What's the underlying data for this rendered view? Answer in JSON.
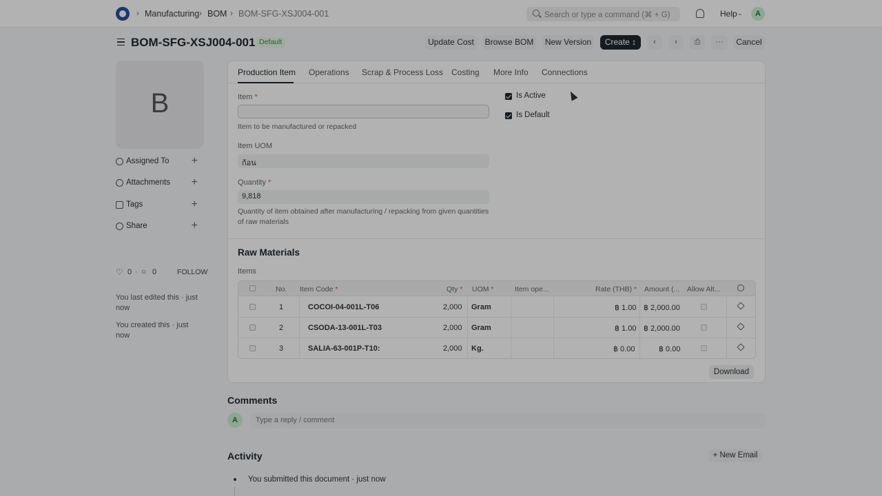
{
  "topbar": {
    "breadcrumbs": [
      "Manufacturing",
      "BOM",
      "BOM-SFG-XSJ004-001"
    ],
    "search_placeholder": "Search or type a command (⌘ + G)",
    "help_label": "Help",
    "avatar_initial": "A"
  },
  "header": {
    "title": "BOM-SFG-XSJ004-001",
    "status_badge": "Default",
    "buttons": {
      "update_cost": "Update Cost",
      "browse_bom": "Browse BOM",
      "new_version": "New Version",
      "create": "Create ↕",
      "prev": "‹",
      "next": "›",
      "print": "⎙",
      "more": "···",
      "cancel": "Cancel"
    }
  },
  "sidebar": {
    "image_letter": "B",
    "items": [
      {
        "label": "Assigned To",
        "icon": "assign-icon"
      },
      {
        "label": "Attachments",
        "icon": "paperclip-icon"
      },
      {
        "label": "Tags",
        "icon": "tag-icon"
      },
      {
        "label": "Share",
        "icon": "share-icon"
      }
    ],
    "likes": "0",
    "comments": "0",
    "follow_label": "FOLLOW",
    "last_edited": "You last edited this · just now",
    "created": "You created this · just now"
  },
  "tabs": [
    "Production Item",
    "Operations",
    "Scrap & Process Loss",
    "Costing",
    "More Info",
    "Connections"
  ],
  "form": {
    "item_label": "Item",
    "item_value": "",
    "item_desc": "Item to be manufactured or repacked",
    "uom_label": "Item UOM",
    "uom_value": "ก้อน",
    "qty_label": "Quantity",
    "qty_value": "9,818",
    "qty_desc": "Quantity of item obtained after manufacturing / repacking from given quantities of raw materials",
    "is_active_label": "Is Active",
    "is_active": true,
    "is_default_label": "Is Default",
    "is_default": true
  },
  "raw_materials": {
    "section_title": "Raw Materials",
    "table_label": "Items",
    "columns": [
      "No.",
      "Item Code",
      "Qty",
      "UOM",
      "Item ope...",
      "Rate (THB)",
      "Amount (...",
      "Allow Alt..."
    ],
    "rows": [
      {
        "no": "1",
        "item_code": "COCOI-04-001L-T06",
        "qty": "2,000",
        "uom": "Gram",
        "item_op": "",
        "rate": "฿ 1.00",
        "amount": "฿ 2,000.00"
      },
      {
        "no": "2",
        "item_code": "CSODA-13-001L-T03",
        "qty": "2,000",
        "uom": "Gram",
        "item_op": "",
        "rate": "฿ 1.00",
        "amount": "฿ 2,000.00"
      },
      {
        "no": "3",
        "item_code": "SALIA-63-001P-T10:",
        "qty": "2,000",
        "uom": "Kg.",
        "item_op": "",
        "rate": "฿ 0.00",
        "amount": "฿ 0.00"
      }
    ],
    "download_label": "Download"
  },
  "comments": {
    "title": "Comments",
    "avatar_initial": "A",
    "placeholder": "Type a reply / comment"
  },
  "activity": {
    "title": "Activity",
    "new_email_label": "+ New Email",
    "entries": [
      "You submitted this document · just now"
    ]
  }
}
